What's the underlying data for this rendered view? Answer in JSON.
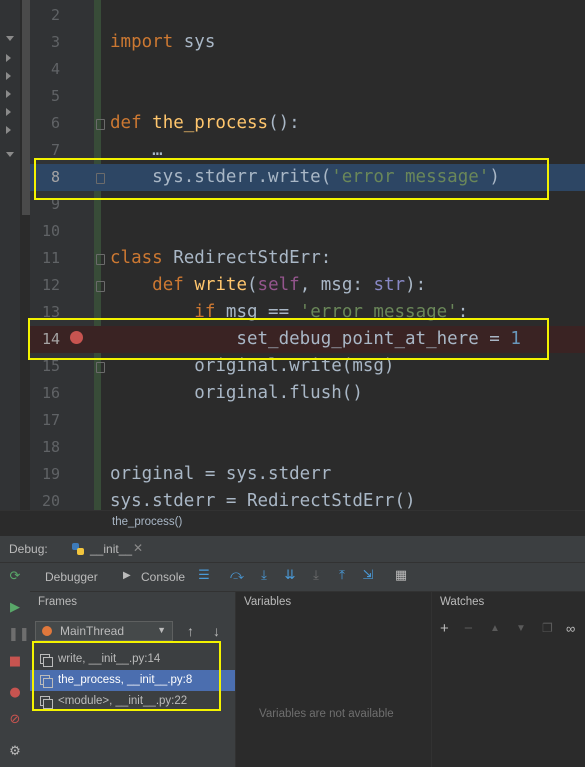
{
  "editor": {
    "lines": [
      {
        "num": "2",
        "code": []
      },
      {
        "num": "3",
        "code": [
          {
            "t": "import",
            "c": "kw"
          },
          {
            "t": " sys",
            "c": ""
          }
        ]
      },
      {
        "num": "4",
        "code": []
      },
      {
        "num": "5",
        "code": []
      },
      {
        "num": "6",
        "code": [
          {
            "t": "def",
            "c": "kw"
          },
          {
            "t": " ",
            "c": ""
          },
          {
            "t": "the_process",
            "c": "fn"
          },
          {
            "t": "():",
            "c": ""
          }
        ]
      },
      {
        "num": "7",
        "code": [
          {
            "t": "    …",
            "c": ""
          }
        ]
      },
      {
        "num": "8",
        "code": [
          {
            "t": "    sys.stderr.write(",
            "c": ""
          },
          {
            "t": "'error message'",
            "c": "str"
          },
          {
            "t": ")",
            "c": ""
          }
        ]
      },
      {
        "num": "9",
        "code": []
      },
      {
        "num": "10",
        "code": []
      },
      {
        "num": "11",
        "code": [
          {
            "t": "class",
            "c": "kw"
          },
          {
            "t": " RedirectStdErr:",
            "c": ""
          }
        ]
      },
      {
        "num": "12",
        "code": [
          {
            "t": "    ",
            "c": ""
          },
          {
            "t": "def",
            "c": "kw"
          },
          {
            "t": " ",
            "c": ""
          },
          {
            "t": "write",
            "c": "fn"
          },
          {
            "t": "(",
            "c": ""
          },
          {
            "t": "self",
            "c": "self"
          },
          {
            "t": ", msg: ",
            "c": ""
          },
          {
            "t": "str",
            "c": "bi"
          },
          {
            "t": "):",
            "c": ""
          }
        ]
      },
      {
        "num": "13",
        "code": [
          {
            "t": "        ",
            "c": ""
          },
          {
            "t": "if",
            "c": "kw"
          },
          {
            "t": " msg == ",
            "c": ""
          },
          {
            "t": "'error message'",
            "c": "str"
          },
          {
            "t": ":",
            "c": ""
          }
        ]
      },
      {
        "num": "14",
        "code": [
          {
            "t": "            set_debug_point_at_here = ",
            "c": ""
          },
          {
            "t": "1",
            "c": "num"
          }
        ]
      },
      {
        "num": "15",
        "code": [
          {
            "t": "        original.write(msg)",
            "c": ""
          }
        ]
      },
      {
        "num": "16",
        "code": [
          {
            "t": "        original.flush()",
            "c": ""
          }
        ]
      },
      {
        "num": "17",
        "code": []
      },
      {
        "num": "18",
        "code": []
      },
      {
        "num": "19",
        "code": [
          {
            "t": "original = sys.stderr",
            "c": ""
          }
        ]
      },
      {
        "num": "20",
        "code": [
          {
            "t": "sys.stderr = RedirectStdErr()",
            "c": ""
          }
        ]
      }
    ],
    "breadcrumb": "the_process()"
  },
  "debug": {
    "label": "Debug:",
    "run_tab": "__init__",
    "tabs": {
      "debugger": "Debugger",
      "console": "Console"
    },
    "frames_title": "Frames",
    "variables_title": "Variables",
    "watches_title": "Watches",
    "thread": "MainThread",
    "frames": [
      {
        "label": "write, __init__.py:14",
        "selected": false
      },
      {
        "label": "the_process, __init__.py:8",
        "selected": true
      },
      {
        "label": "<module>, __init__.py:22",
        "selected": false
      }
    ],
    "variables_empty": "Variables are not available"
  },
  "colors": {
    "highlight_box": "#f3f300",
    "selection": "#4b6eaf",
    "breakpoint": "#c75450"
  }
}
